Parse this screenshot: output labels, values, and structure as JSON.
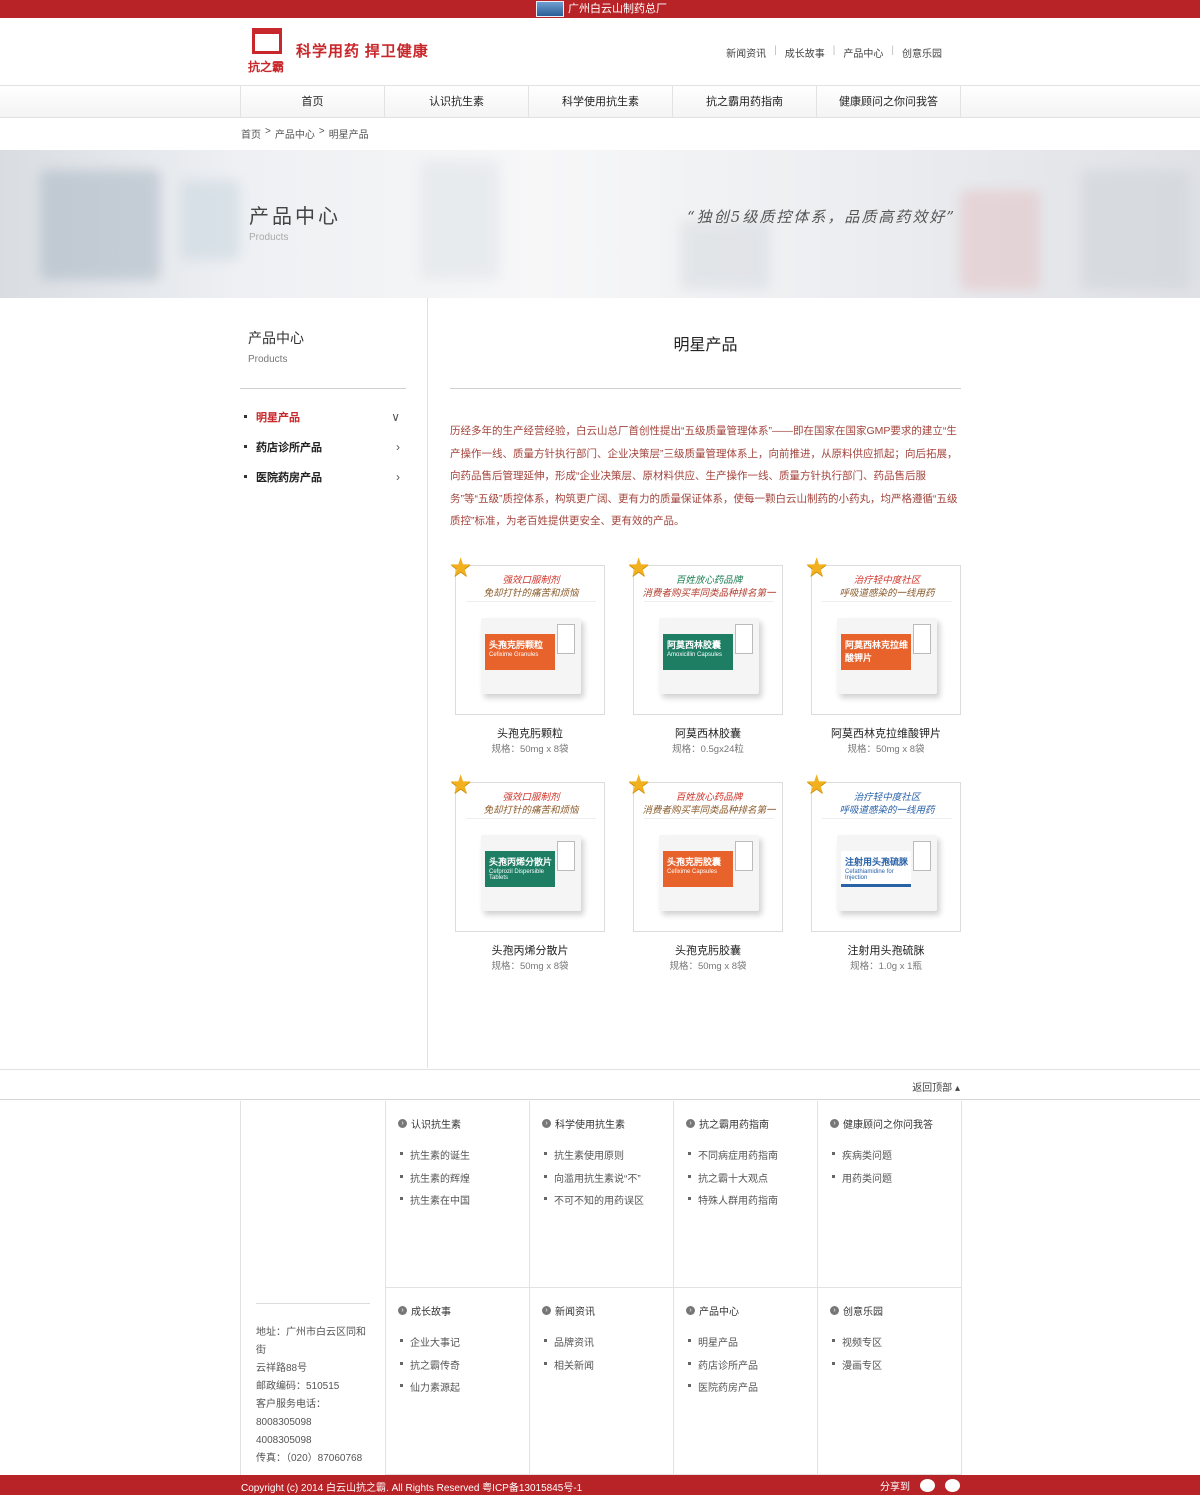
{
  "topbar": {
    "title": "广州白云山制药总厂"
  },
  "header": {
    "logo_text": "抗之霸",
    "slogan": "科学用药  捍卫健康",
    "links": [
      "新闻资讯",
      "成长故事",
      "产品中心",
      "创意乐园"
    ]
  },
  "nav": [
    "首页",
    "认识抗生素",
    "科学使用抗生素",
    "抗之霸用药指南",
    "健康顾问之你问我答"
  ],
  "breadcrumb": [
    "首页",
    ">",
    "产品中心",
    ">",
    "明星产品"
  ],
  "banner": {
    "title": "产品中心",
    "subtitle": "Products",
    "quote": "“独创5级质控体系，品质高药效好”"
  },
  "sidebar": {
    "title": "产品中心",
    "subtitle": "Products",
    "items": [
      {
        "label": "明星产品",
        "active": true,
        "chevron": "∨"
      },
      {
        "label": "药店诊所产品",
        "active": false,
        "chevron": "›"
      },
      {
        "label": "医院药房产品",
        "active": false,
        "chevron": "›"
      }
    ]
  },
  "main": {
    "title": "明星产品",
    "intro": "历经多年的生产经营经验，白云山总厂首创性提出“五级质量管理体系”——即在国家在国家GMP要求的建立“生产操作一线、质量方针执行部门、企业决策层”三级质量管理体系上，向前推进，从原料供应抓起；向后拓展，向药品售后管理延伸，形成“企业决策层、原材料供应、生产操作一线、质量方针执行部门、药品售后服务”等“五级”质控体系，构筑更广阔、更有力的质量保证体系，使每一颗白云山制药的小药丸，均严格遵循“五级质控”标准，为老百姓提供更安全、更有效的产品。"
  },
  "products": [
    {
      "tag1": "强效口服制剂",
      "tag2": "免却打针的痛苦和烦恼",
      "name": "头孢克肟颗粒",
      "spec": "规格：50mg x 8袋",
      "box_title": "头孢克肟颗粒",
      "box_sub": "Cefixime Granules",
      "theme": "orange",
      "box_color": "#e8622b"
    },
    {
      "tag1": "百姓放心药品牌",
      "tag2": "消费者购买率同类品种排名第一",
      "name": "阿莫西林胶囊",
      "spec": "规格：0.5gx24粒",
      "box_title": "阿莫西林胶囊",
      "box_sub": "Amoxicillin Capsules",
      "theme": "green",
      "box_color": "#1d7e63"
    },
    {
      "tag1": "治疗轻中度社区",
      "tag2": "呼吸道感染的一线用药",
      "name": "阿莫西林克拉维酸钾片",
      "spec": "规格：50mg x 8袋",
      "box_title": "阿莫西林克拉维酸钾片",
      "box_sub": "",
      "theme": "orange",
      "box_color": "#e8622b"
    },
    {
      "tag1": "强效口服制剂",
      "tag2": "免却打针的痛苦和烦恼",
      "name": "头孢丙烯分散片",
      "spec": "规格：50mg x 8袋",
      "box_title": "头孢丙烯分散片",
      "box_sub": "Cefprozil Dispersible Tablets",
      "theme": "orange",
      "box_color": "#1d7e63"
    },
    {
      "tag1": "百姓放心药品牌",
      "tag2": "消费者购买率同类品种排名第一",
      "name": "头孢克肟胶囊",
      "spec": "规格：50mg x 8袋",
      "box_title": "头孢克肟胶囊",
      "box_sub": "Cefixime Capsules",
      "theme": "orange",
      "box_color": "#e8622b"
    },
    {
      "tag1": "治疗轻中度社区",
      "tag2": "呼吸道感染的一线用药",
      "name": "注射用头孢硫脒",
      "spec": "规格：1.0g x 1瓶",
      "box_title": "注射用头孢硫脒",
      "box_sub": "Cefathiamidine for Injection",
      "theme": "blue",
      "box_color": "#ffffff"
    }
  ],
  "backtop": "返回顶部 ▴",
  "footer": {
    "contact": [
      "地址：广州市白云区同和街",
      "云祥路88号",
      "邮政编码：510515",
      "客户服务电话：",
      "8008305098",
      "4008305098",
      "传真：（020）87060768"
    ],
    "columns": [
      {
        "title": "认识抗生素",
        "items": [
          "抗生素的诞生",
          "抗生素的辉煌",
          "抗生素在中国"
        ]
      },
      {
        "title": "科学使用抗生素",
        "items": [
          "抗生素使用原则",
          "向滥用抗生素说“不”",
          "不可不知的用药误区"
        ]
      },
      {
        "title": "抗之霸用药指南",
        "items": [
          "不同病症用药指南",
          "抗之霸十大观点",
          "特殊人群用药指南"
        ]
      },
      {
        "title": "健康顾问之你问我答",
        "items": [
          "疾病类问题",
          "用药类问题"
        ]
      },
      {
        "title": "成长故事",
        "items": [
          "企业大事记",
          "抗之霸传奇",
          "仙力素源起"
        ]
      },
      {
        "title": "新闻资讯",
        "items": [
          "品牌资讯",
          "相关新闻"
        ]
      },
      {
        "title": "产品中心",
        "items": [
          "明星产品",
          "药店诊所产品",
          "医院药房产品"
        ]
      },
      {
        "title": "创意乐园",
        "items": [
          "视频专区",
          "漫画专区"
        ]
      }
    ],
    "copyright": "Copyright (c) 2014 白云山抗之霸. All Rights Reserved 粤ICP备13015845号-1",
    "share_label": "分享到"
  },
  "colors": {
    "brand_red": "#b82327",
    "accent_red": "#c8282c",
    "intro_text": "#a3443c"
  }
}
